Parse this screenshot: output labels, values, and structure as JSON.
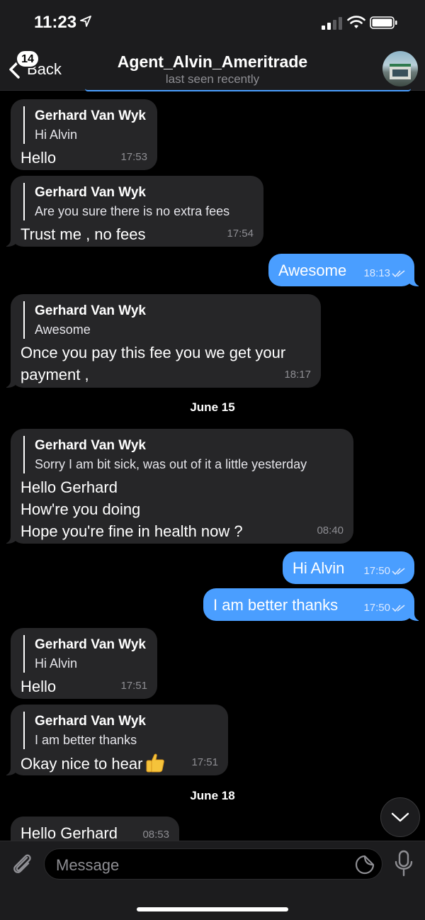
{
  "status_bar": {
    "time": "11:23",
    "icons": [
      "location-arrow-icon",
      "cellular-signal-icon",
      "wifi-icon",
      "battery-icon"
    ]
  },
  "header": {
    "back_label": "Back",
    "unread_badge": "14",
    "title": "Agent_Alvin_Ameritrade",
    "subtitle": "last seen recently"
  },
  "messages": [
    {
      "dir": "in",
      "reply_name": "Gerhard Van Wyk",
      "reply_text": "Hi Alvin",
      "text": "Hello",
      "time": "17:53"
    },
    {
      "dir": "in",
      "reply_name": "Gerhard Van Wyk",
      "reply_text": "Are you sure there is no extra fees",
      "text": "Trust me , no fees",
      "time": "17:54"
    },
    {
      "dir": "out",
      "text": "Awesome",
      "time": "18:13"
    },
    {
      "dir": "in",
      "reply_name": "Gerhard Van Wyk",
      "reply_text": "Awesome",
      "text": "Once you pay this fee you we get your\npayment ,",
      "time": "18:17"
    },
    {
      "dir": "in",
      "reply_name": "Gerhard Van Wyk",
      "reply_text": "Sorry I am bit sick, was out of it a little yesterday",
      "text": "Hello Gerhard\nHow're you doing\nHope you're fine in health now ?",
      "time": "08:40"
    },
    {
      "dir": "out",
      "text": "Hi Alvin",
      "time": "17:50"
    },
    {
      "dir": "out",
      "text": "I am better thanks",
      "time": "17:50"
    },
    {
      "dir": "in",
      "reply_name": "Gerhard Van Wyk",
      "reply_text": "Hi Alvin",
      "text": "Hello",
      "time": "17:51"
    },
    {
      "dir": "in",
      "reply_name": "Gerhard Van Wyk",
      "reply_text": "I am better thanks",
      "text": "Okay nice to hear",
      "time": "17:51",
      "emoji": "thumbs-up-icon"
    },
    {
      "dir": "in",
      "text": "Hello Gerhard",
      "time": "08:53"
    }
  ],
  "date_separators": [
    "June 15",
    "June 18"
  ],
  "input": {
    "placeholder": "Message"
  },
  "colors": {
    "outgoing_bubble": "#4a9eff",
    "incoming_bubble": "#262628",
    "background": "#000000"
  }
}
